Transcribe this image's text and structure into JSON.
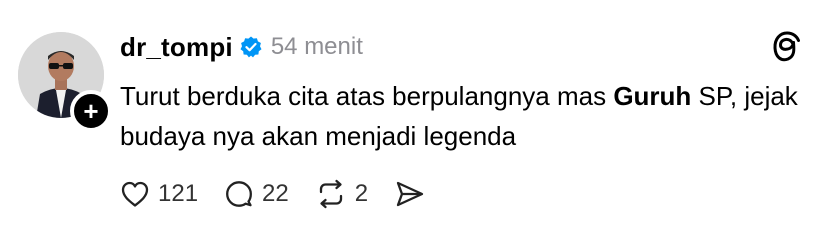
{
  "post": {
    "username": "dr_tompi",
    "verified": true,
    "timestamp": "54 menit",
    "text_before": "Turut berduka cita atas berpulangnya mas ",
    "text_bold": "Guruh",
    "text_after": " SP, jejak budaya nya akan menjadi legenda"
  },
  "actions": {
    "likes": "121",
    "replies": "22",
    "reposts": "2"
  },
  "icons": {
    "follow": "plus-icon",
    "verified": "verified-badge-icon",
    "app": "threads-logo-icon",
    "like": "heart-icon",
    "reply": "comment-bubble-icon",
    "repost": "repost-icon",
    "share": "send-icon"
  },
  "colors": {
    "verified_blue": "#0095f6",
    "muted_text": "#8e8e93"
  }
}
